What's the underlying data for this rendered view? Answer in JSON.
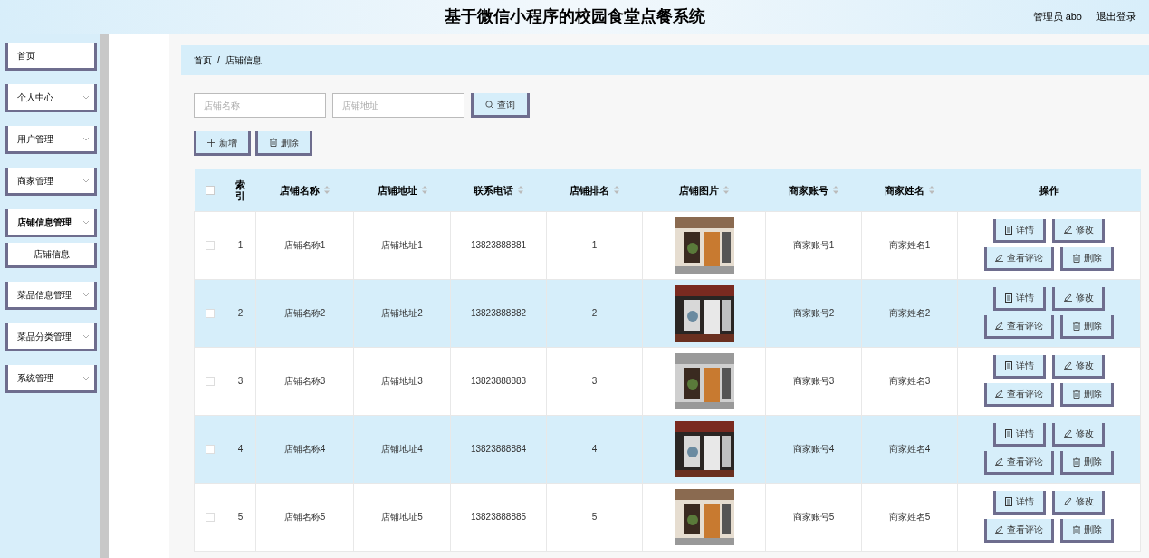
{
  "header": {
    "title": "基于微信小程序的校园食堂点餐系统",
    "user": "管理员 abo",
    "logout": "退出登录"
  },
  "sidebar": {
    "items": [
      {
        "label": "首页",
        "has_arrow": false,
        "expanded": false
      },
      {
        "label": "个人中心",
        "has_arrow": true,
        "expanded": false
      },
      {
        "label": "用户管理",
        "has_arrow": true,
        "expanded": false
      },
      {
        "label": "商家管理",
        "has_arrow": true,
        "expanded": false
      },
      {
        "label": "店铺信息管理",
        "has_arrow": true,
        "expanded": true,
        "children": [
          {
            "label": "店铺信息"
          }
        ]
      },
      {
        "label": "菜品信息管理",
        "has_arrow": true,
        "expanded": false
      },
      {
        "label": "菜品分类管理",
        "has_arrow": true,
        "expanded": false
      },
      {
        "label": "系统管理",
        "has_arrow": true,
        "expanded": false
      }
    ]
  },
  "breadcrumb": [
    "首页",
    "/",
    "店铺信息"
  ],
  "search": {
    "fields": [
      {
        "placeholder": "店铺名称"
      },
      {
        "placeholder": "店铺地址"
      }
    ],
    "button": "查询"
  },
  "toolbar": [
    {
      "label": "新增",
      "kind": "add"
    },
    {
      "label": "删除",
      "kind": "delete"
    }
  ],
  "table": {
    "all_checked": false,
    "columns": [
      {
        "label": "索引",
        "sortable": false
      },
      {
        "label": "店铺名称",
        "sortable": true
      },
      {
        "label": "店铺地址",
        "sortable": true
      },
      {
        "label": "联系电话",
        "sortable": true
      },
      {
        "label": "店铺排名",
        "sortable": true
      },
      {
        "label": "店铺图片",
        "sortable": true
      },
      {
        "label": "商家账号",
        "sortable": true
      },
      {
        "label": "商家姓名",
        "sortable": true
      },
      {
        "label": "操作",
        "sortable": false
      }
    ],
    "rows": [
      {
        "checked": false,
        "cells": [
          "1",
          "店铺名称1",
          "店铺地址1",
          "13823888881",
          "1"
        ],
        "picture": {
          "kind": "picture"
        },
        "cells2": [
          "商家账号1",
          "商家姓名1"
        ],
        "actions": [
          {
            "label": "详情",
            "kind": "detail"
          },
          {
            "label": "修改",
            "kind": "edit"
          },
          {
            "label": "查看评论",
            "kind": "edit"
          },
          {
            "label": "删除",
            "kind": "delete"
          }
        ]
      },
      {
        "checked": false,
        "cells": [
          "2",
          "店铺名称2",
          "店铺地址2",
          "13823888882",
          "2"
        ],
        "picture": {
          "kind": "picture"
        },
        "cells2": [
          "商家账号2",
          "商家姓名2"
        ],
        "actions": [
          {
            "label": "详情",
            "kind": "detail"
          },
          {
            "label": "修改",
            "kind": "edit"
          },
          {
            "label": "查看评论",
            "kind": "edit"
          },
          {
            "label": "删除",
            "kind": "delete"
          }
        ]
      },
      {
        "checked": false,
        "cells": [
          "3",
          "店铺名称3",
          "店铺地址3",
          "13823888883",
          "3"
        ],
        "picture": {
          "kind": "picture"
        },
        "cells2": [
          "商家账号3",
          "商家姓名3"
        ],
        "actions": [
          {
            "label": "详情",
            "kind": "detail"
          },
          {
            "label": "修改",
            "kind": "edit"
          },
          {
            "label": "查看评论",
            "kind": "edit"
          },
          {
            "label": "删除",
            "kind": "delete"
          }
        ]
      },
      {
        "checked": false,
        "cells": [
          "4",
          "店铺名称4",
          "店铺地址4",
          "13823888884",
          "4"
        ],
        "picture": {
          "kind": "picture"
        },
        "cells2": [
          "商家账号4",
          "商家姓名4"
        ],
        "actions": [
          {
            "label": "详情",
            "kind": "detail"
          },
          {
            "label": "修改",
            "kind": "edit"
          },
          {
            "label": "查看评论",
            "kind": "edit"
          },
          {
            "label": "删除",
            "kind": "delete"
          }
        ]
      },
      {
        "checked": false,
        "cells": [
          "5",
          "店铺名称5",
          "店铺地址5",
          "13823888885",
          "5"
        ],
        "picture": {
          "kind": "picture"
        },
        "cells2": [
          "商家账号5",
          "商家姓名5"
        ],
        "actions": [
          {
            "label": "详情",
            "kind": "detail"
          },
          {
            "label": "修改",
            "kind": "edit"
          },
          {
            "label": "查看评论",
            "kind": "edit"
          },
          {
            "label": "删除",
            "kind": "delete"
          }
        ]
      }
    ]
  }
}
